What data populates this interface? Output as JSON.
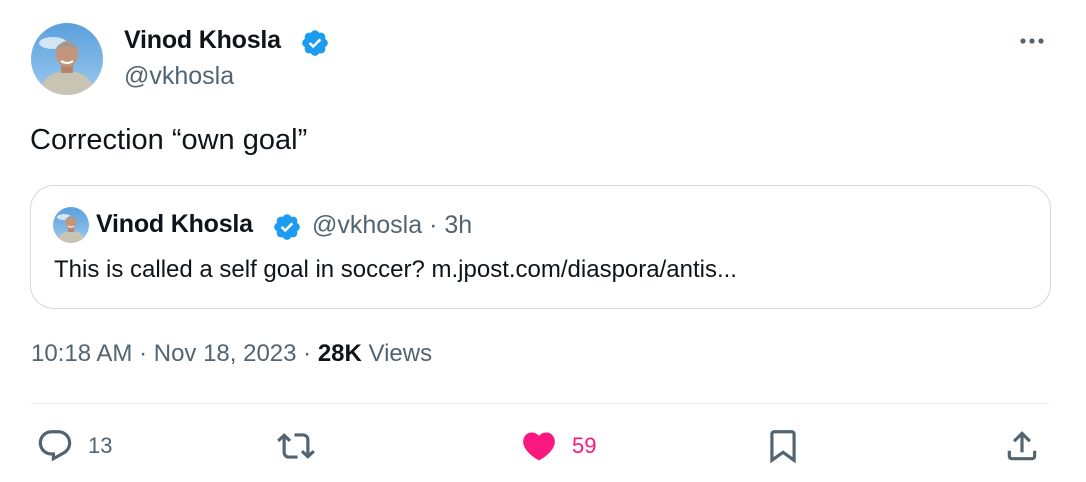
{
  "tweet": {
    "author": {
      "name": "Vinod Khosla",
      "handle": "@vkhosla"
    },
    "text": "Correction “own goal”",
    "timestamp": "10:18 AM · Nov 18, 2023 · ",
    "views_count": "28K",
    "views_label": " Views"
  },
  "quoted_tweet": {
    "author": {
      "name": "Vinod Khosla",
      "handle": "@vkhosla"
    },
    "meta": "@vkhosla · 3h",
    "text": "This is called a self goal in soccer? m.jpost.com/diaspora/antis..."
  },
  "actions": {
    "replies": "13",
    "likes": "59",
    "like_color": "#f91880"
  },
  "colors": {
    "verified": "#1d9bf0",
    "secondary_text": "#536471",
    "border": "#cfd9de"
  },
  "icons": [
    "verified-badge-icon",
    "more-icon",
    "reply-icon",
    "retweet-icon",
    "like-icon",
    "bookmark-icon",
    "share-icon"
  ]
}
